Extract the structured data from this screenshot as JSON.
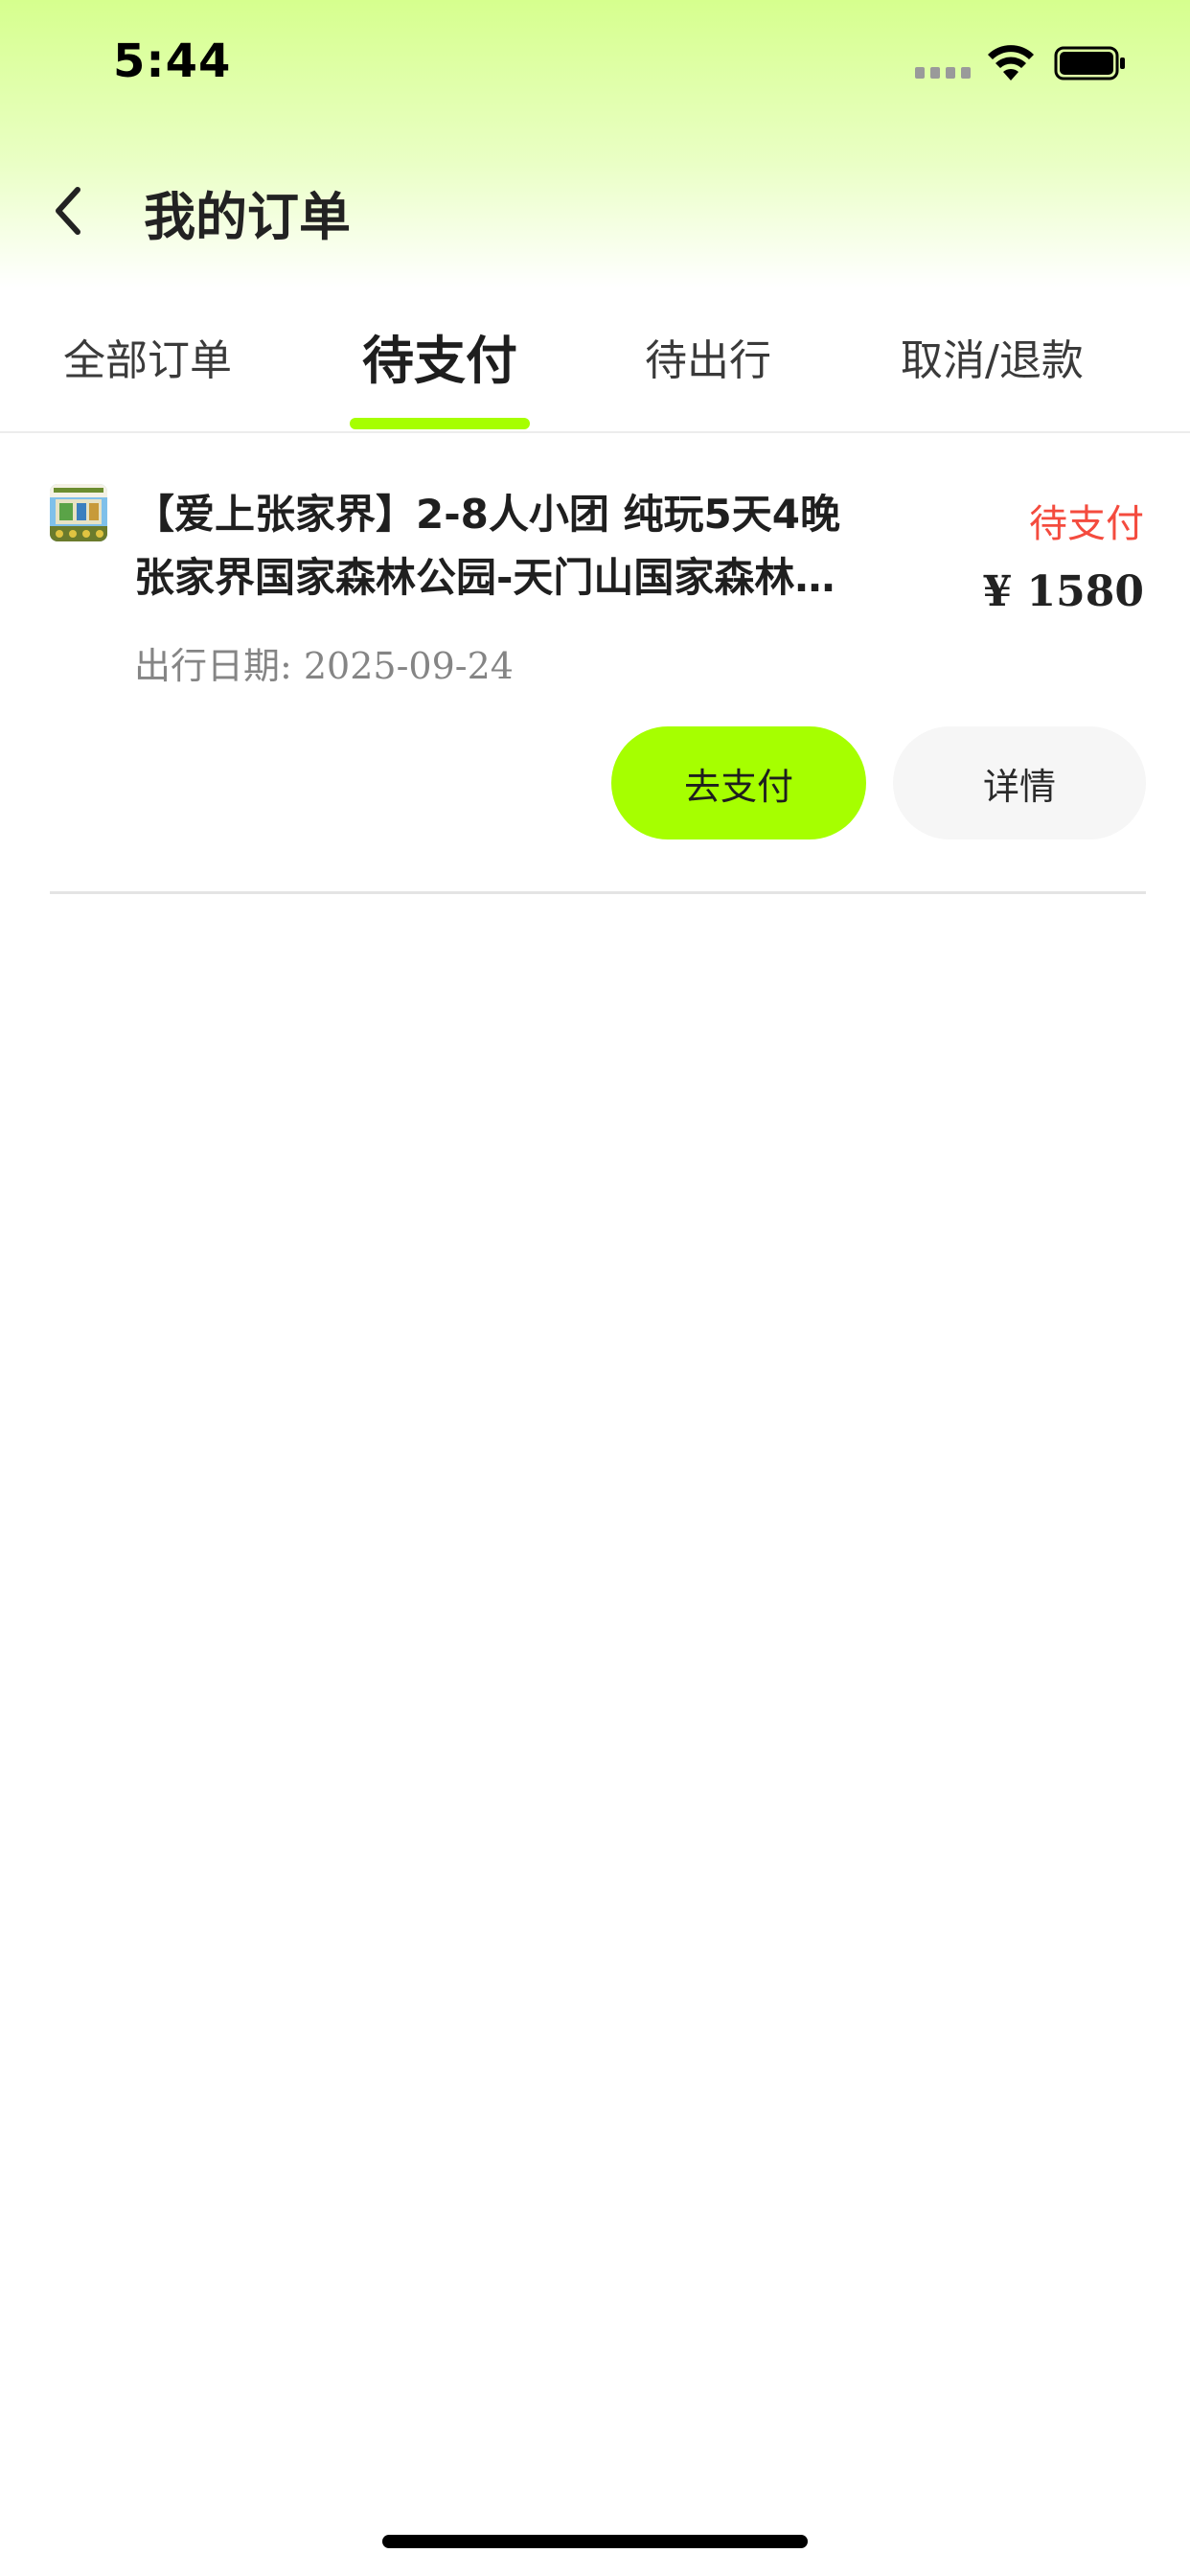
{
  "status_bar": {
    "time": "5:44"
  },
  "nav": {
    "title": "我的订单",
    "back_icon": "chevron-left-icon"
  },
  "tabs": [
    {
      "label": "全部订单",
      "active": false
    },
    {
      "label": "待支付",
      "active": true
    },
    {
      "label": "待出行",
      "active": false
    },
    {
      "label": "取消/退款",
      "active": false
    }
  ],
  "orders": [
    {
      "title": "【爱上张家界】2-8人小团 纯玩5天4晚 张家界国家森林公园-天门山国家森林公园",
      "status": "待支付",
      "price": "¥  1580",
      "date": "出行日期: 2025-09-24",
      "pay_label": "去支付",
      "detail_label": "详情"
    }
  ],
  "colors": {
    "accent": "#a6ff00",
    "status_pending": "#f44b3e",
    "header_gradient_top": "#d6ff8e"
  }
}
